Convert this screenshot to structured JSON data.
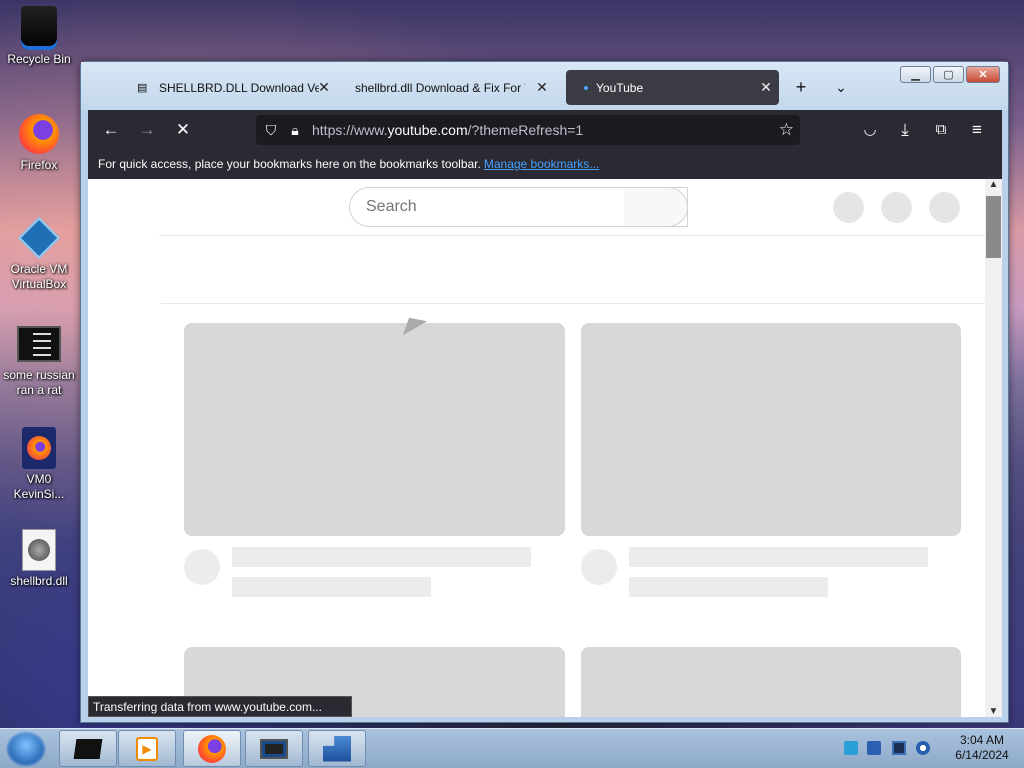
{
  "desktop": {
    "icons": [
      {
        "label": "Recycle Bin",
        "icon": "recycle-bin-icon"
      },
      {
        "label": "Firefox",
        "icon": "firefox-icon"
      },
      {
        "label": "Oracle VM VirtualBox",
        "icon": "virtualbox-icon"
      },
      {
        "label": "some russian ran a rat",
        "icon": "terminal-icon"
      },
      {
        "label": "VM0 KevinSi...",
        "icon": "firefox-document-icon"
      },
      {
        "label": "shellbrd.dll",
        "icon": "dll-file-icon"
      }
    ]
  },
  "browser": {
    "tabs": [
      {
        "label": "SHELLBRD.DLL Download Vers",
        "favicon": "server-icon"
      },
      {
        "label": "shellbrd.dll Download & Fix For W",
        "favicon": ""
      },
      {
        "label": "YouTube",
        "favicon": "loading-dot"
      }
    ],
    "url": {
      "prefix": "https://www.",
      "host": "youtube.com",
      "path": "/?themeRefresh=1"
    },
    "bookmarks_bar": {
      "text": "For quick access, place your bookmarks here on the bookmarks toolbar.",
      "link": "Manage bookmarks..."
    },
    "status": "Transferring data from www.youtube.com..."
  },
  "youtube": {
    "search_placeholder": "Search"
  },
  "taskbar": {
    "time": "3:04 AM",
    "date": "6/14/2024"
  }
}
